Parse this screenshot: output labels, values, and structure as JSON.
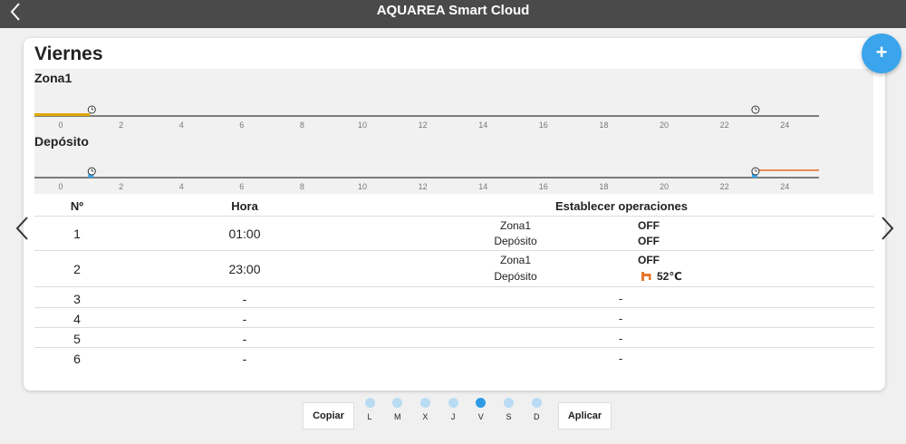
{
  "app": {
    "title": "AQUAREA Smart Cloud"
  },
  "schedule": {
    "day_title": "Viernes",
    "zones": [
      {
        "label": "Zona1",
        "color": "#e0a800",
        "events": [
          1,
          23
        ]
      },
      {
        "label": "Depósito",
        "color": "#e8742c",
        "events": [
          1,
          23
        ]
      }
    ],
    "axis_ticks": [
      "0",
      "2",
      "4",
      "6",
      "8",
      "10",
      "12",
      "14",
      "16",
      "18",
      "20",
      "22",
      "24"
    ],
    "columns": {
      "num": "Nº",
      "time": "Hora",
      "ops": "Establecer operaciones"
    },
    "rows": [
      {
        "num": "1",
        "time": "01:00",
        "ops": [
          {
            "zone": "Zona1",
            "value": "OFF"
          },
          {
            "zone": "Depósito",
            "value": "OFF"
          }
        ]
      },
      {
        "num": "2",
        "time": "23:00",
        "ops": [
          {
            "zone": "Zona1",
            "value": "OFF"
          },
          {
            "zone": "Depósito",
            "value": "52℃",
            "icon": "tap-icon"
          }
        ]
      },
      {
        "num": "3",
        "time": "-",
        "ops_empty": "-"
      },
      {
        "num": "4",
        "time": "-",
        "ops_empty": "-"
      },
      {
        "num": "5",
        "time": "-",
        "ops_empty": "-"
      },
      {
        "num": "6",
        "time": "-",
        "ops_empty": "-"
      }
    ]
  },
  "footer": {
    "copy_label": "Copiar",
    "apply_label": "Aplicar",
    "days": [
      "L",
      "M",
      "X",
      "J",
      "V",
      "S",
      "D"
    ],
    "active_day": "V"
  },
  "colors": {
    "accent": "#3aa4ec",
    "topbar": "#4a4a4a",
    "heat_marker": "#3aa4ec"
  }
}
